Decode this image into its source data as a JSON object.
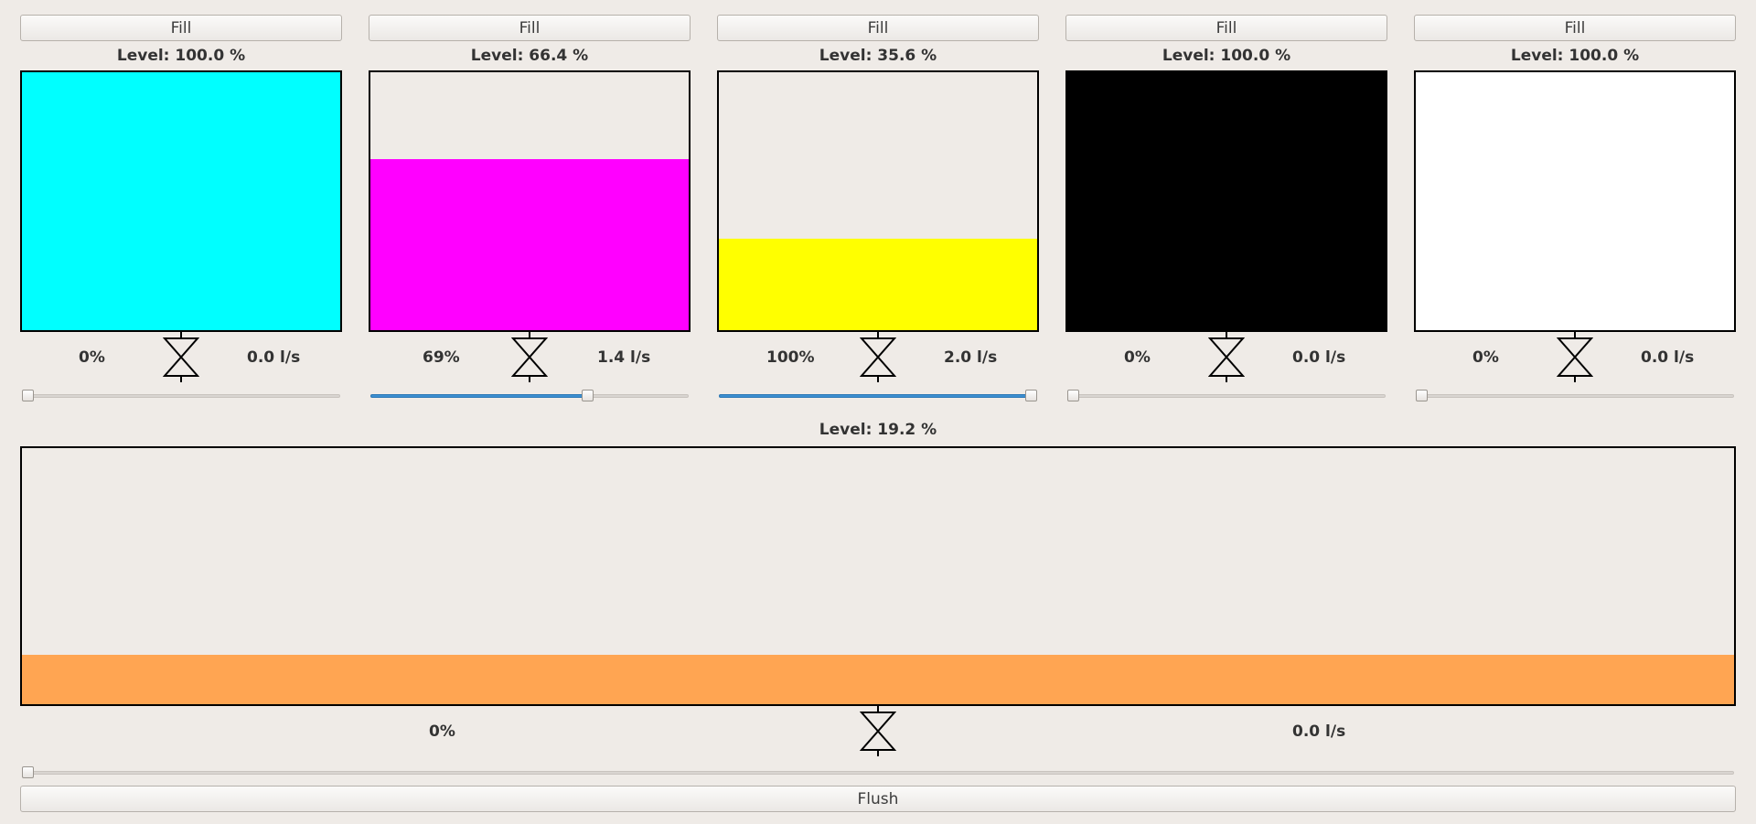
{
  "tanks": [
    {
      "fill_label": "Fill",
      "level_text": "Level: 100.0 %",
      "level": 1.0,
      "color": "#00ffff",
      "valve_pct": "0%",
      "flow": "0.0 l/s",
      "slider": 0.0
    },
    {
      "fill_label": "Fill",
      "level_text": "Level: 66.4 %",
      "level": 0.664,
      "color": "#ff00ff",
      "valve_pct": "69%",
      "flow": "1.4 l/s",
      "slider": 0.69
    },
    {
      "fill_label": "Fill",
      "level_text": "Level: 35.6 %",
      "level": 0.356,
      "color": "#ffff00",
      "valve_pct": "100%",
      "flow": "2.0 l/s",
      "slider": 1.0
    },
    {
      "fill_label": "Fill",
      "level_text": "Level: 100.0 %",
      "level": 1.0,
      "color": "#000000",
      "valve_pct": "0%",
      "flow": "0.0 l/s",
      "slider": 0.0
    },
    {
      "fill_label": "Fill",
      "level_text": "Level: 100.0 %",
      "level": 1.0,
      "color": "#ffffff",
      "valve_pct": "0%",
      "flow": "0.0 l/s",
      "slider": 0.0
    }
  ],
  "mixer": {
    "level_text": "Level: 19.2 %",
    "level": 0.192,
    "color": "#ffa552",
    "valve_pct": "0%",
    "flow": "0.0 l/s",
    "slider": 0.0,
    "flush_label": "Flush"
  },
  "icons": {
    "valve": "valve-icon"
  }
}
